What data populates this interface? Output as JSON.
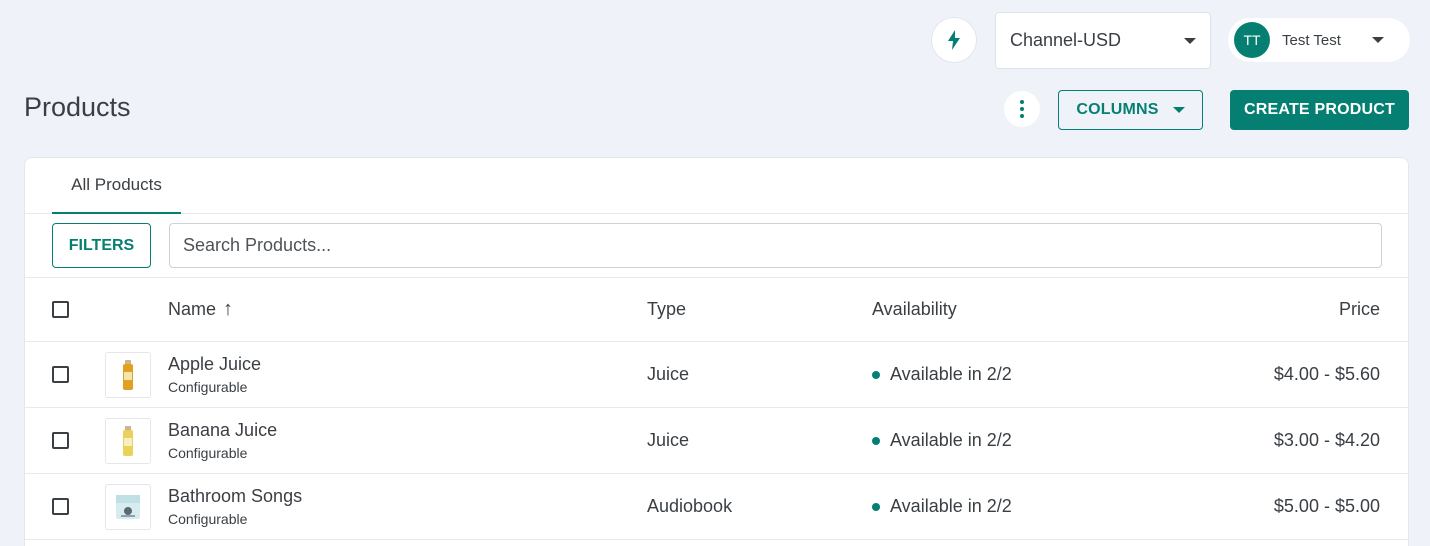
{
  "header": {
    "channel": "Channel-USD",
    "user": {
      "initials": "TT",
      "name": "Test Test"
    }
  },
  "page": {
    "title": "Products",
    "columns_label": "COLUMNS",
    "create_label": "CREATE PRODUCT"
  },
  "tabs": [
    {
      "label": "All Products"
    }
  ],
  "filters": {
    "button_label": "FILTERS",
    "search_placeholder": "Search Products..."
  },
  "table": {
    "headers": {
      "name": "Name",
      "sort_arrow": "↑",
      "type": "Type",
      "availability": "Availability",
      "price": "Price"
    },
    "rows": [
      {
        "name": "Apple Juice",
        "subtitle": "Configurable",
        "type": "Juice",
        "availability": "Available in 2/2",
        "price": "$4.00 - $5.60"
      },
      {
        "name": "Banana Juice",
        "subtitle": "Configurable",
        "type": "Juice",
        "availability": "Available in 2/2",
        "price": "$3.00 - $4.20"
      },
      {
        "name": "Bathroom Songs",
        "subtitle": "Configurable",
        "type": "Audiobook",
        "availability": "Available in 2/2",
        "price": "$5.00 - $5.00"
      }
    ]
  },
  "colors": {
    "accent": "#067f73",
    "background": "#eff3f9"
  }
}
